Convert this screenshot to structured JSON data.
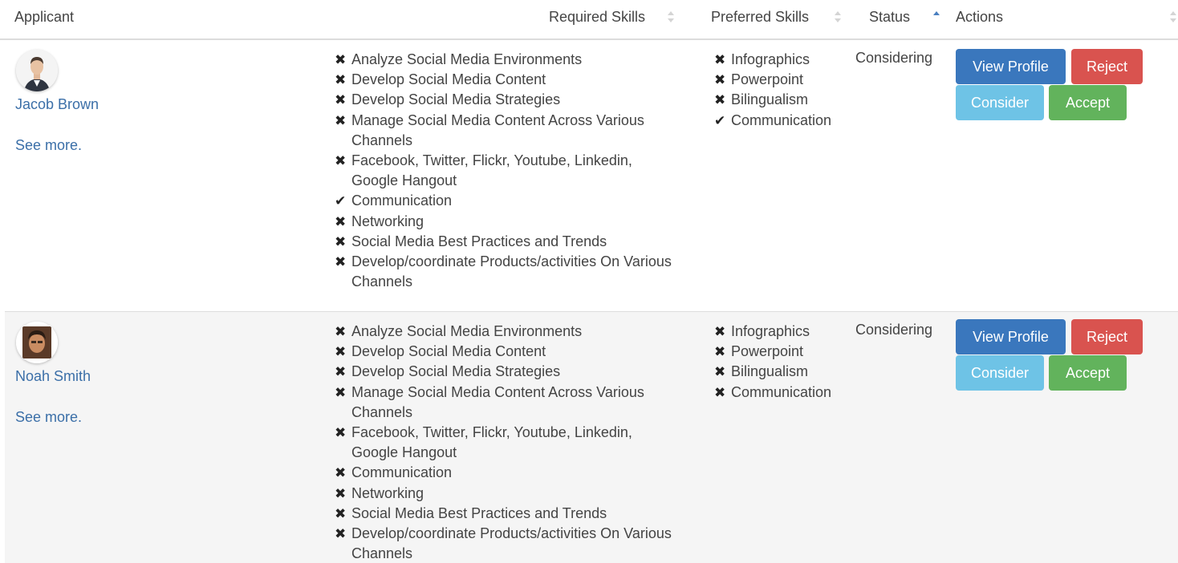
{
  "header": {
    "applicant": "Applicant",
    "required_skills": "Required Skills",
    "preferred_skills": "Preferred Skills",
    "status": "Status",
    "actions": "Actions"
  },
  "actions": {
    "view_profile": "View Profile",
    "reject": "Reject",
    "consider": "Consider",
    "accept": "Accept"
  },
  "applicants": [
    {
      "name": "Jacob Brown",
      "see_more": "See more.",
      "status": "Considering",
      "required_skills": [
        {
          "label": "Analyze Social Media Environments",
          "met": false
        },
        {
          "label": "Develop Social Media Content",
          "met": false
        },
        {
          "label": "Develop Social Media Strategies",
          "met": false
        },
        {
          "label": "Manage Social Media Content Across Various Channels",
          "met": false
        },
        {
          "label": "Facebook, Twitter, Flickr, Youtube, Linkedin, Google Hangout",
          "met": false
        },
        {
          "label": "Communication",
          "met": true
        },
        {
          "label": "Networking",
          "met": false
        },
        {
          "label": "Social Media Best Practices and Trends",
          "met": false
        },
        {
          "label": "Develop/coordinate Products/activities On Various Channels",
          "met": false
        }
      ],
      "preferred_skills": [
        {
          "label": "Infographics",
          "met": false
        },
        {
          "label": "Powerpoint",
          "met": false
        },
        {
          "label": "Bilingualism",
          "met": false
        },
        {
          "label": "Communication",
          "met": true
        }
      ]
    },
    {
      "name": "Noah Smith",
      "see_more": "See more.",
      "status": "Considering",
      "required_skills": [
        {
          "label": "Analyze Social Media Environments",
          "met": false
        },
        {
          "label": "Develop Social Media Content",
          "met": false
        },
        {
          "label": "Develop Social Media Strategies",
          "met": false
        },
        {
          "label": "Manage Social Media Content Across Various Channels",
          "met": false
        },
        {
          "label": "Facebook, Twitter, Flickr, Youtube, Linkedin, Google Hangout",
          "met": false
        },
        {
          "label": "Communication",
          "met": false
        },
        {
          "label": "Networking",
          "met": false
        },
        {
          "label": "Social Media Best Practices and Trends",
          "met": false
        },
        {
          "label": "Develop/coordinate Products/activities On Various Channels",
          "met": false
        }
      ],
      "preferred_skills": [
        {
          "label": "Infographics",
          "met": false
        },
        {
          "label": "Powerpoint",
          "met": false
        },
        {
          "label": "Bilingualism",
          "met": false
        },
        {
          "label": "Communication",
          "met": false
        }
      ]
    }
  ],
  "icons": {
    "unmet": "times-icon",
    "met": "check-icon"
  },
  "colors": {
    "link": "#3b6fa8",
    "view_profile": "#3a77bd",
    "reject": "#d9534f",
    "consider": "#6ec3e6",
    "accept": "#62b35c",
    "sort_active": "#4a7fc0"
  }
}
